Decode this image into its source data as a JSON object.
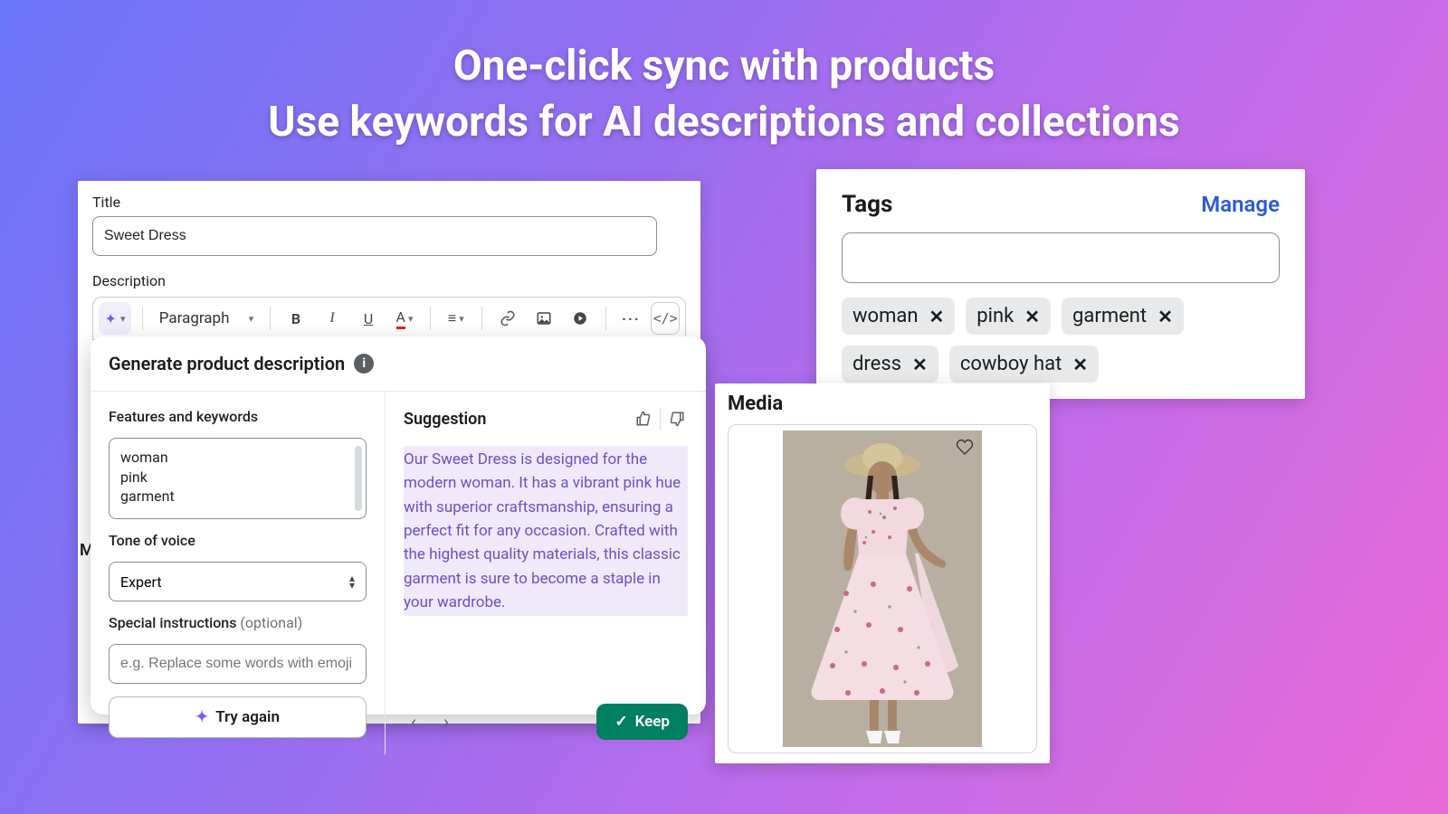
{
  "headline_line1": "One-click sync with products",
  "headline_line2": "Use keywords for AI descriptions and collections",
  "editor": {
    "title_label": "Title",
    "title_value": "Sweet Dress",
    "description_label": "Description",
    "toolbar": {
      "paragraph_label": "Paragraph"
    }
  },
  "generate": {
    "heading": "Generate product description",
    "features_label": "Features and keywords",
    "features_text": "woman\npink\ngarment",
    "tone_label": "Tone of voice",
    "tone_value": "Expert",
    "instructions_label": "Special instructions ",
    "instructions_optional": "(optional)",
    "instructions_placeholder": "e.g. Replace some words with emoji",
    "try_again_label": "Try again",
    "suggestion_label": "Suggestion",
    "suggestion_text": "Our Sweet Dress is designed for the modern woman. It has a vibrant pink hue with superior craftsmanship, ensuring a perfect fit for any occasion. Crafted with the highest quality materials, this classic garment is sure to become a staple in your wardrobe.",
    "keep_label": "Keep"
  },
  "tags": {
    "title": "Tags",
    "manage_label": "Manage",
    "items": [
      "woman",
      "pink",
      "garment",
      "dress",
      "cowboy hat"
    ]
  },
  "media": {
    "title": "Media"
  },
  "m_peek": "M"
}
